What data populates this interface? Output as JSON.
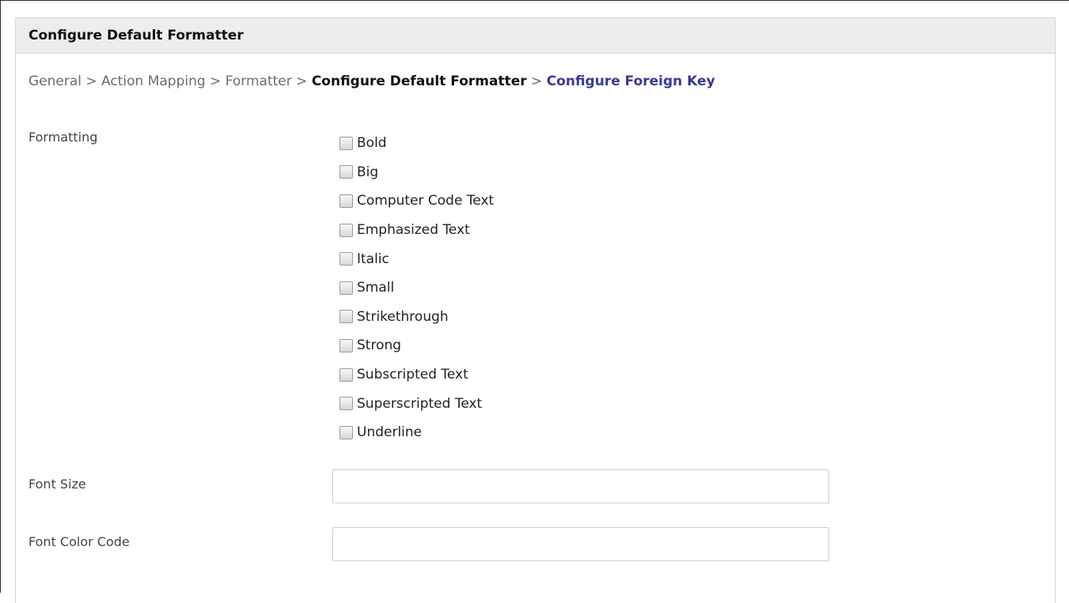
{
  "panel": {
    "title": "Configure Default Formatter"
  },
  "breadcrumb": {
    "items": [
      "General",
      "Action Mapping",
      "Formatter"
    ],
    "separator": ">",
    "current": "Configure Default Formatter",
    "next": "Configure Foreign Key"
  },
  "formatting": {
    "label": "Formatting",
    "options": [
      {
        "label": "Bold",
        "checked": false
      },
      {
        "label": "Big",
        "checked": false
      },
      {
        "label": "Computer Code Text",
        "checked": false
      },
      {
        "label": "Emphasized Text",
        "checked": false
      },
      {
        "label": "Italic",
        "checked": false
      },
      {
        "label": "Small",
        "checked": false
      },
      {
        "label": "Strikethrough",
        "checked": false
      },
      {
        "label": "Strong",
        "checked": false
      },
      {
        "label": "Subscripted Text",
        "checked": false
      },
      {
        "label": "Superscripted Text",
        "checked": false
      },
      {
        "label": "Underline",
        "checked": false
      }
    ]
  },
  "font_size": {
    "label": "Font Size",
    "value": ""
  },
  "font_color": {
    "label": "Font Color Code",
    "value": ""
  }
}
